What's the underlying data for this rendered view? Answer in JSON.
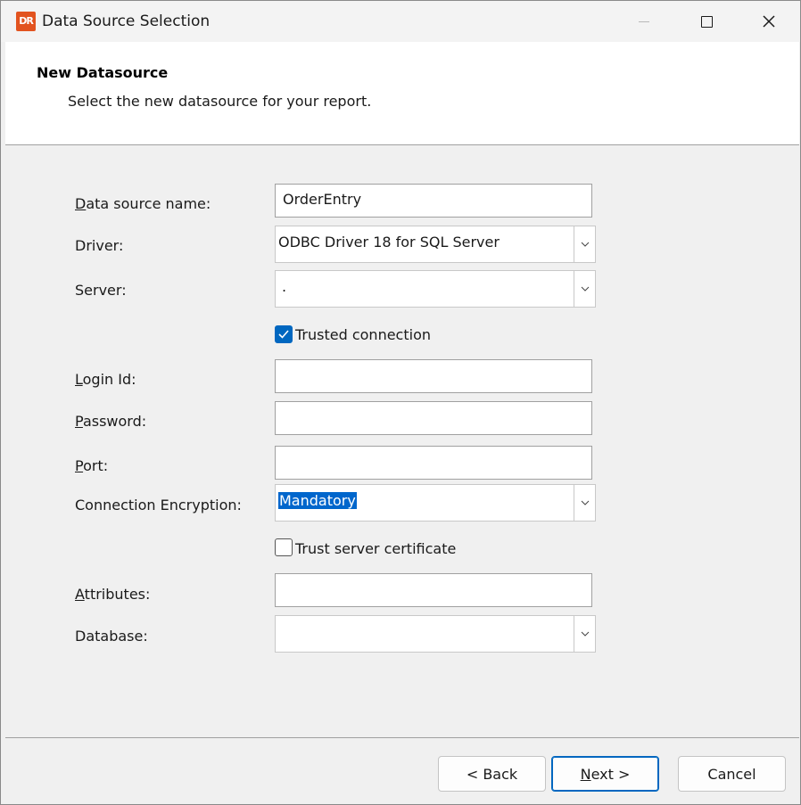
{
  "window": {
    "app_icon_text": "DR",
    "title": "Data Source Selection"
  },
  "header": {
    "title": "New Datasource",
    "subtitle": "Select the new datasource for your report."
  },
  "form": {
    "data_source_name": {
      "label_mnemonic": "D",
      "label_rest": "ata source name:",
      "value": "OrderEntry"
    },
    "driver": {
      "label": "Driver:",
      "value": "ODBC Driver 18 for SQL Server"
    },
    "server": {
      "label": "Server:",
      "value": "."
    },
    "trusted_connection": {
      "label": "Trusted connection",
      "checked": true
    },
    "login_id": {
      "label_mnemonic": "L",
      "label_rest": "ogin Id:",
      "value": ""
    },
    "password": {
      "label_mnemonic": "P",
      "label_rest": "assword:",
      "value": ""
    },
    "port": {
      "label_mnemonic": "P",
      "label_rest": "ort:",
      "value": ""
    },
    "connection_encryption": {
      "label": "Connection Encryption:",
      "value": "Mandatory"
    },
    "trust_server_certificate": {
      "label": "Trust server certificate",
      "checked": false
    },
    "attributes": {
      "label_mnemonic": "A",
      "label_rest": "ttributes:",
      "value": ""
    },
    "database": {
      "label": "Database:",
      "value": ""
    }
  },
  "buttons": {
    "back": "< Back",
    "next_mnemonic": "N",
    "next_rest": "ext >",
    "cancel": "Cancel"
  },
  "colors": {
    "accent": "#0067c0",
    "selection": "#0066cc",
    "app_icon": "#e2531f"
  }
}
